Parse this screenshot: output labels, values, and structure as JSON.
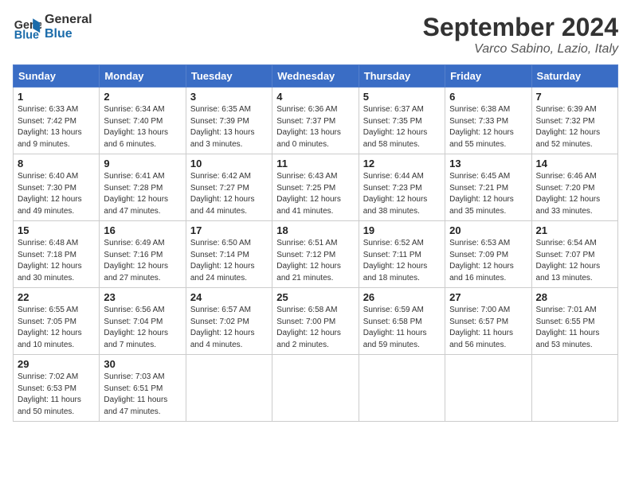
{
  "logo": {
    "text_general": "General",
    "text_blue": "Blue"
  },
  "title": "September 2024",
  "subtitle": "Varco Sabino, Lazio, Italy",
  "days_of_week": [
    "Sunday",
    "Monday",
    "Tuesday",
    "Wednesday",
    "Thursday",
    "Friday",
    "Saturday"
  ],
  "weeks": [
    [
      {
        "day": "1",
        "sunrise": "6:33 AM",
        "sunset": "7:42 PM",
        "daylight": "13 hours and 9 minutes."
      },
      {
        "day": "2",
        "sunrise": "6:34 AM",
        "sunset": "7:40 PM",
        "daylight": "13 hours and 6 minutes."
      },
      {
        "day": "3",
        "sunrise": "6:35 AM",
        "sunset": "7:39 PM",
        "daylight": "13 hours and 3 minutes."
      },
      {
        "day": "4",
        "sunrise": "6:36 AM",
        "sunset": "7:37 PM",
        "daylight": "13 hours and 0 minutes."
      },
      {
        "day": "5",
        "sunrise": "6:37 AM",
        "sunset": "7:35 PM",
        "daylight": "12 hours and 58 minutes."
      },
      {
        "day": "6",
        "sunrise": "6:38 AM",
        "sunset": "7:33 PM",
        "daylight": "12 hours and 55 minutes."
      },
      {
        "day": "7",
        "sunrise": "6:39 AM",
        "sunset": "7:32 PM",
        "daylight": "12 hours and 52 minutes."
      }
    ],
    [
      {
        "day": "8",
        "sunrise": "6:40 AM",
        "sunset": "7:30 PM",
        "daylight": "12 hours and 49 minutes."
      },
      {
        "day": "9",
        "sunrise": "6:41 AM",
        "sunset": "7:28 PM",
        "daylight": "12 hours and 47 minutes."
      },
      {
        "day": "10",
        "sunrise": "6:42 AM",
        "sunset": "7:27 PM",
        "daylight": "12 hours and 44 minutes."
      },
      {
        "day": "11",
        "sunrise": "6:43 AM",
        "sunset": "7:25 PM",
        "daylight": "12 hours and 41 minutes."
      },
      {
        "day": "12",
        "sunrise": "6:44 AM",
        "sunset": "7:23 PM",
        "daylight": "12 hours and 38 minutes."
      },
      {
        "day": "13",
        "sunrise": "6:45 AM",
        "sunset": "7:21 PM",
        "daylight": "12 hours and 35 minutes."
      },
      {
        "day": "14",
        "sunrise": "6:46 AM",
        "sunset": "7:20 PM",
        "daylight": "12 hours and 33 minutes."
      }
    ],
    [
      {
        "day": "15",
        "sunrise": "6:48 AM",
        "sunset": "7:18 PM",
        "daylight": "12 hours and 30 minutes."
      },
      {
        "day": "16",
        "sunrise": "6:49 AM",
        "sunset": "7:16 PM",
        "daylight": "12 hours and 27 minutes."
      },
      {
        "day": "17",
        "sunrise": "6:50 AM",
        "sunset": "7:14 PM",
        "daylight": "12 hours and 24 minutes."
      },
      {
        "day": "18",
        "sunrise": "6:51 AM",
        "sunset": "7:12 PM",
        "daylight": "12 hours and 21 minutes."
      },
      {
        "day": "19",
        "sunrise": "6:52 AM",
        "sunset": "7:11 PM",
        "daylight": "12 hours and 18 minutes."
      },
      {
        "day": "20",
        "sunrise": "6:53 AM",
        "sunset": "7:09 PM",
        "daylight": "12 hours and 16 minutes."
      },
      {
        "day": "21",
        "sunrise": "6:54 AM",
        "sunset": "7:07 PM",
        "daylight": "12 hours and 13 minutes."
      }
    ],
    [
      {
        "day": "22",
        "sunrise": "6:55 AM",
        "sunset": "7:05 PM",
        "daylight": "12 hours and 10 minutes."
      },
      {
        "day": "23",
        "sunrise": "6:56 AM",
        "sunset": "7:04 PM",
        "daylight": "12 hours and 7 minutes."
      },
      {
        "day": "24",
        "sunrise": "6:57 AM",
        "sunset": "7:02 PM",
        "daylight": "12 hours and 4 minutes."
      },
      {
        "day": "25",
        "sunrise": "6:58 AM",
        "sunset": "7:00 PM",
        "daylight": "12 hours and 2 minutes."
      },
      {
        "day": "26",
        "sunrise": "6:59 AM",
        "sunset": "6:58 PM",
        "daylight": "11 hours and 59 minutes."
      },
      {
        "day": "27",
        "sunrise": "7:00 AM",
        "sunset": "6:57 PM",
        "daylight": "11 hours and 56 minutes."
      },
      {
        "day": "28",
        "sunrise": "7:01 AM",
        "sunset": "6:55 PM",
        "daylight": "11 hours and 53 minutes."
      }
    ],
    [
      {
        "day": "29",
        "sunrise": "7:02 AM",
        "sunset": "6:53 PM",
        "daylight": "11 hours and 50 minutes."
      },
      {
        "day": "30",
        "sunrise": "7:03 AM",
        "sunset": "6:51 PM",
        "daylight": "11 hours and 47 minutes."
      },
      null,
      null,
      null,
      null,
      null
    ]
  ]
}
